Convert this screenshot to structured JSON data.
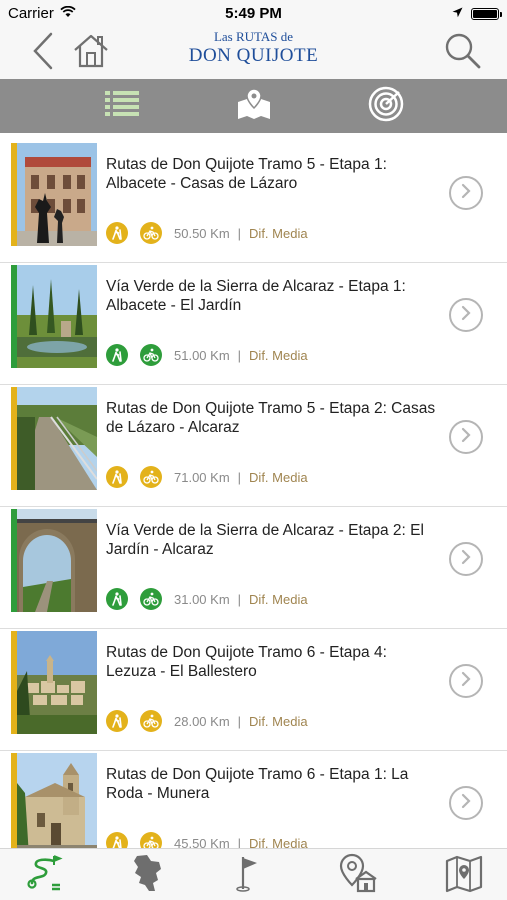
{
  "status_bar": {
    "carrier": "Carrier",
    "time": "5:49 PM",
    "wifi_icon": "wifi-icon",
    "location_icon": "location-arrow-icon",
    "battery_icon": "battery-icon"
  },
  "header": {
    "back_icon": "chevron-left-icon",
    "home_icon": "home-icon",
    "logo_line1": "Las RUTAS de",
    "logo_line2": "DON QUIJOTE",
    "search_icon": "search-icon",
    "brand_color": "#1f4e9a"
  },
  "toolbar": {
    "background": "#8c8c8c",
    "items": [
      {
        "icon": "list-icon",
        "active": true
      },
      {
        "icon": "map-pin-icon",
        "active": false
      },
      {
        "icon": "radar-icon",
        "active": false
      }
    ]
  },
  "colors": {
    "rutas_accent": "#e3b21b",
    "via_verde_accent": "#2e9d3b",
    "difficulty_text": "#a08550",
    "distance_text": "#8a8a8a"
  },
  "routes": [
    {
      "title": "Rutas de Don Quijote Tramo 5 - Etapa 1: Albacete - Casas de Lázaro",
      "distance": "50.50 Km",
      "separator": "|",
      "difficulty": "Dif. Media",
      "category": "rutas"
    },
    {
      "title": "Vía Verde de la Sierra de Alcaraz - Etapa 1: Albacete - El Jardín",
      "distance": "51.00 Km",
      "separator": "|",
      "difficulty": "Dif. Media",
      "category": "via_verde"
    },
    {
      "title": "Rutas de Don Quijote Tramo 5 - Etapa 2: Casas de Lázaro - Alcaraz",
      "distance": "71.00 Km",
      "separator": "|",
      "difficulty": "Dif. Media",
      "category": "rutas"
    },
    {
      "title": "Vía Verde de la Sierra de Alcaraz - Etapa 2: El Jardín - Alcaraz",
      "distance": "31.00 Km",
      "separator": "|",
      "difficulty": "Dif. Media",
      "category": "via_verde"
    },
    {
      "title": "Rutas de Don Quijote Tramo 6 - Etapa 4: Lezuza - El Ballestero",
      "distance": "28.00 Km",
      "separator": "|",
      "difficulty": "Dif. Media",
      "category": "rutas"
    },
    {
      "title": "Rutas de Don Quijote Tramo 6 - Etapa 1: La Roda - Munera",
      "distance": "45.50 Km",
      "separator": "|",
      "difficulty": "Dif. Media",
      "category": "rutas"
    }
  ],
  "route_icons": {
    "hiking_icon": "hiker-icon",
    "cycling_icon": "cyclist-icon",
    "detail_icon": "chevron-right-circle-icon"
  },
  "tabbar": {
    "items": [
      {
        "icon": "route-icon",
        "active": true
      },
      {
        "icon": "province-map-icon",
        "active": false
      },
      {
        "icon": "flag-icon",
        "active": false
      },
      {
        "icon": "location-lodging-icon",
        "active": false
      },
      {
        "icon": "folded-map-icon",
        "active": false
      }
    ],
    "active_color": "#2e9d3b",
    "inactive_color": "#6e6e6e"
  }
}
